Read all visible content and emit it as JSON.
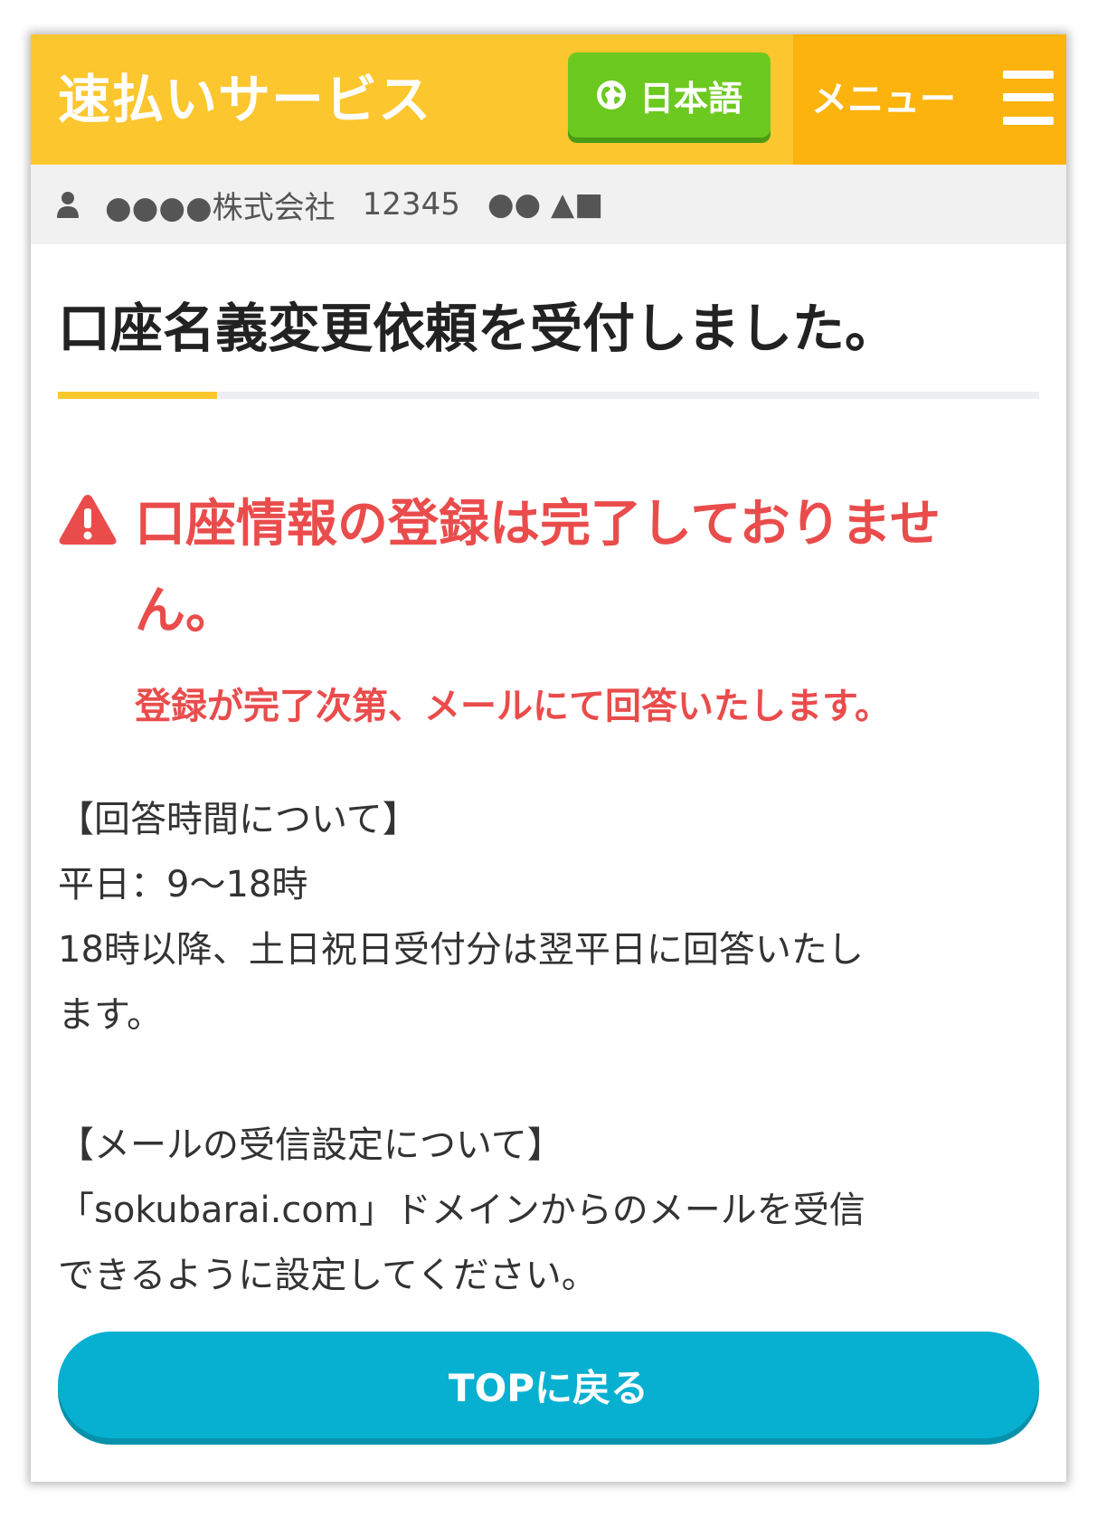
{
  "header": {
    "brand": "速払いサービス",
    "language_label": "日本語",
    "language_icon": "globe-icon",
    "menu_label": "メニュー",
    "menu_icon": "hamburger-icon",
    "colors": {
      "header_bg": "#fcc62f",
      "menu_bg": "#fdb30d",
      "language_bg": "#6cc91f"
    }
  },
  "account": {
    "icon": "user-icon",
    "company": "●●●●株式会社",
    "id": "12345",
    "name": "●● ▲■"
  },
  "main": {
    "title": "口座名義変更依頼を受付しました。",
    "warning": {
      "icon": "warning-icon",
      "title": "口座情報の登録は完了しておりません。",
      "subtitle": "登録が完了次第、メールにて回答いたします。",
      "color": "#ea4c4c"
    },
    "info": {
      "reply_time_heading": "【回答時間について】",
      "weekday_hours": " 平日：9〜18時",
      "after_hours_line1": " 18時以降、土日祝日受付分は翌平日に回答いたし",
      "after_hours_line2": "ます。",
      "mail_heading": "【メールの受信設定について】",
      "mail_line1": "「sokubarai.com」ドメインからのメールを受信",
      "mail_line2": "できるように設定してください。"
    },
    "top_button_label": "TOPに戻る",
    "top_button_color": "#07b0d0"
  }
}
